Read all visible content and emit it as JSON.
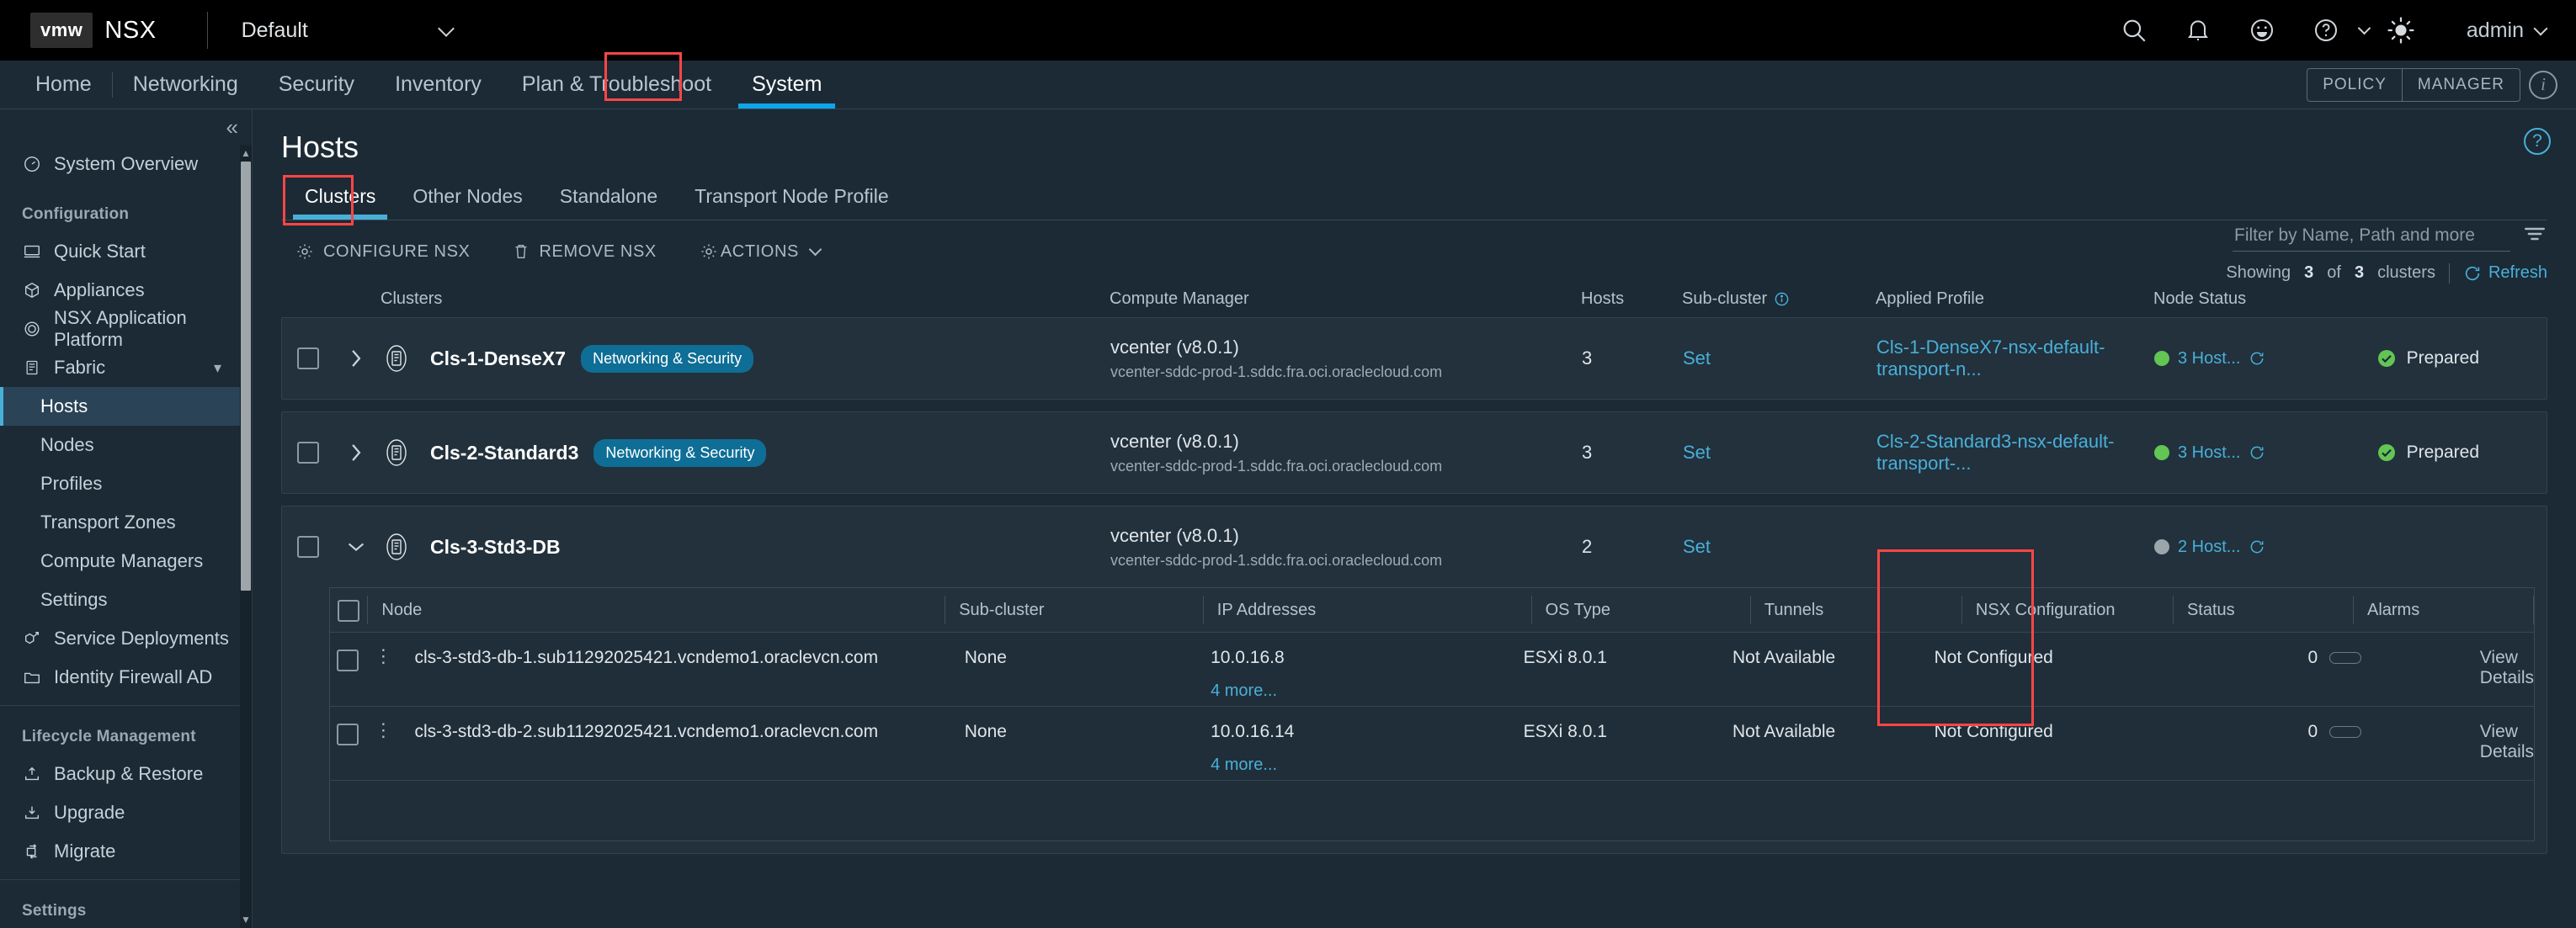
{
  "topbar": {
    "logo_text": "vmw",
    "product": "NSX",
    "project": "Default",
    "icons": [
      "search-icon",
      "bell-icon",
      "smiley-icon",
      "help-icon",
      "brightness-icon"
    ],
    "user": "admin"
  },
  "nav": {
    "items": [
      {
        "label": "Home",
        "active": false
      },
      {
        "label": "Networking",
        "active": false
      },
      {
        "label": "Security",
        "active": false
      },
      {
        "label": "Inventory",
        "active": false
      },
      {
        "label": "Plan & Troubleshoot",
        "active": false
      },
      {
        "label": "System",
        "active": true,
        "annotated": true
      }
    ],
    "mode_toggle": [
      "POLICY",
      "MANAGER"
    ],
    "info_label": "i"
  },
  "sidebar": {
    "overview": {
      "label": "System Overview",
      "icon": "gauge-icon"
    },
    "group_configuration": "Configuration",
    "configuration_items": [
      {
        "label": "Quick Start",
        "icon": "monitor-icon"
      },
      {
        "label": "Appliances",
        "icon": "cube-icon"
      },
      {
        "label": "NSX Application Platform",
        "icon": "gear-ring-icon"
      },
      {
        "label": "Fabric",
        "icon": "rack-icon",
        "expandable": true
      }
    ],
    "fabric_children": [
      {
        "label": "Hosts",
        "active": true
      },
      {
        "label": "Nodes",
        "active": false
      },
      {
        "label": "Profiles",
        "active": false
      },
      {
        "label": "Transport Zones",
        "active": false
      },
      {
        "label": "Compute Managers",
        "active": false
      },
      {
        "label": "Settings",
        "active": false
      }
    ],
    "after_fabric": [
      {
        "label": "Service Deployments",
        "icon": "deploy-icon"
      },
      {
        "label": "Identity Firewall AD",
        "icon": "folder-icon"
      }
    ],
    "group_lifecycle": "Lifecycle Management",
    "lifecycle_items": [
      {
        "label": "Backup & Restore",
        "icon": "backup-icon"
      },
      {
        "label": "Upgrade",
        "icon": "upgrade-icon"
      },
      {
        "label": "Migrate",
        "icon": "migrate-icon"
      }
    ],
    "group_settings": "Settings"
  },
  "page": {
    "title": "Hosts",
    "tabs": [
      {
        "label": "Clusters",
        "active": true,
        "annotated": true
      },
      {
        "label": "Other Nodes",
        "active": false
      },
      {
        "label": "Standalone",
        "active": false
      },
      {
        "label": "Transport Node Profile",
        "active": false
      }
    ],
    "toolbar": {
      "configure_nsx": "CONFIGURE NSX",
      "remove_nsx": "REMOVE NSX",
      "actions": "ACTIONS"
    },
    "filter": {
      "placeholder": "Filter by Name, Path and more",
      "value": ""
    },
    "showing": {
      "prefix": "Showing",
      "count": "3",
      "of": "of",
      "total": "3",
      "suffix": "clusters",
      "refresh": "Refresh"
    }
  },
  "cluster_table": {
    "columns": [
      "Clusters",
      "Compute Manager",
      "Hosts",
      "Sub-cluster",
      "Applied Profile",
      "Node Status"
    ],
    "rows": [
      {
        "name": "Cls-1-DenseX7",
        "badge": "Networking & Security",
        "compute_manager": "vcenter (v8.0.1)",
        "compute_manager_sub": "vcenter-sddc-prod-1.sddc.fra.oci.oraclecloud.com",
        "hosts": "3",
        "sub_cluster": "Set",
        "applied_profile": "Cls-1-DenseX7-nsx-default-transport-n...",
        "node_status": "3 Host...",
        "node_status_color": "#62c554",
        "status": "Prepared",
        "expanded": false
      },
      {
        "name": "Cls-2-Standard3",
        "badge": "Networking & Security",
        "compute_manager": "vcenter (v8.0.1)",
        "compute_manager_sub": "vcenter-sddc-prod-1.sddc.fra.oci.oraclecloud.com",
        "hosts": "3",
        "sub_cluster": "Set",
        "applied_profile": "Cls-2-Standard3-nsx-default-transport-...",
        "node_status": "3 Host...",
        "node_status_color": "#62c554",
        "status": "Prepared",
        "expanded": false
      },
      {
        "name": "Cls-3-Std3-DB",
        "badge": "",
        "compute_manager": "vcenter (v8.0.1)",
        "compute_manager_sub": "vcenter-sddc-prod-1.sddc.fra.oci.oraclecloud.com",
        "hosts": "2",
        "sub_cluster": "Set",
        "applied_profile": "",
        "node_status": "2 Host...",
        "node_status_color": "#9ba5ac",
        "status": "",
        "expanded": true
      }
    ]
  },
  "node_table": {
    "columns": [
      "Node",
      "Sub-cluster",
      "IP Addresses",
      "OS Type",
      "Tunnels",
      "NSX Configuration",
      "Status",
      "Alarms"
    ],
    "annotated_column": "NSX Configuration",
    "rows": [
      {
        "node": "cls-3-std3-db-1.sub11292025421.vcndemo1.oraclevcn.com",
        "sub_cluster": "None",
        "ip": "10.0.16.8",
        "ip_more": "4 more...",
        "os_type": "ESXi 8.0.1",
        "tunnels": "Not Available",
        "nsx_configuration": "Not Configured",
        "status": "",
        "alarms": "0",
        "details": "View Details"
      },
      {
        "node": "cls-3-std3-db-2.sub11292025421.vcndemo1.oraclevcn.com",
        "sub_cluster": "None",
        "ip": "10.0.16.14",
        "ip_more": "4 more...",
        "os_type": "ESXi 8.0.1",
        "tunnels": "Not Available",
        "nsx_configuration": "Not Configured",
        "status": "",
        "alarms": "0",
        "details": "View Details"
      }
    ]
  },
  "colors": {
    "accent": "#49afd9",
    "annotation": "#ff4545",
    "green": "#62c554",
    "badge": "#0e6e96"
  }
}
